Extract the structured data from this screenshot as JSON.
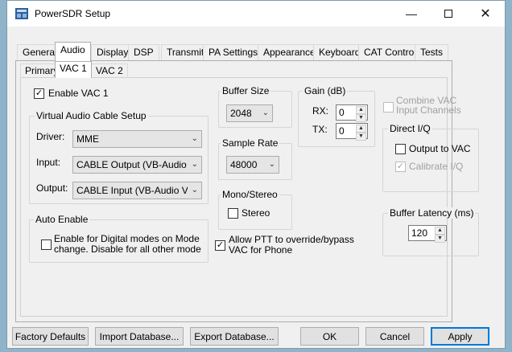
{
  "window": {
    "title": "PowerSDR Setup",
    "caption_buttons": [
      "minimize-icon",
      "maximize-icon",
      "close-icon"
    ]
  },
  "tabs": [
    "General",
    "Audio",
    "Display",
    "DSP",
    "Transmit",
    "PA Settings",
    "Appearance",
    "Keyboard",
    "CAT Control",
    "Tests"
  ],
  "selected_tab": "Audio",
  "subtabs": [
    "Primary",
    "VAC 1",
    "VAC 2"
  ],
  "selected_subtab": "VAC 1",
  "enable_vac": {
    "label": "Enable VAC 1",
    "checked": true
  },
  "vac_setup": {
    "title": "Virtual Audio Cable Setup",
    "driver_label": "Driver:",
    "driver_value": "MME",
    "input_label": "Input:",
    "input_value": "CABLE Output (VB-Audio Virt",
    "output_label": "Output:",
    "output_value": "CABLE Input (VB-Audio Virtu"
  },
  "auto_enable": {
    "title": "Auto Enable",
    "line1": "Enable for Digital modes on Mode",
    "line2": "change.  Disable for all other mode",
    "checked": false
  },
  "buffer_size": {
    "title": "Buffer Size",
    "value": "2048"
  },
  "sample_rate": {
    "title": "Sample Rate",
    "value": "48000"
  },
  "mono_stereo": {
    "title": "Mono/Stereo",
    "stereo_label": "Stereo",
    "checked": false
  },
  "allow_ptt": {
    "line1": "Allow PTT to override/bypass",
    "line2": "VAC for Phone",
    "checked": true
  },
  "gain": {
    "title": "Gain (dB)",
    "rx_label": "RX:",
    "rx_value": "0",
    "tx_label": "TX:",
    "tx_value": "0"
  },
  "combine": {
    "line1": "Combine VAC",
    "line2": "Input Channels",
    "checked": false,
    "disabled": true
  },
  "direct_iq": {
    "title": "Direct I/Q",
    "output_label": "Output to VAC",
    "output_checked": false,
    "calibrate_label": "Calibrate I/Q",
    "calibrate_checked": true
  },
  "buffer_latency": {
    "title": "Buffer Latency (ms)",
    "value": "120"
  },
  "buttons": {
    "factory_defaults": "Factory Defaults",
    "import_database": "Import Database...",
    "export_database": "Export Database...",
    "ok": "OK",
    "cancel": "Cancel",
    "apply": "Apply"
  },
  "colors": {
    "accent": "#0078d7",
    "window_bg": "#f0f0f0"
  }
}
